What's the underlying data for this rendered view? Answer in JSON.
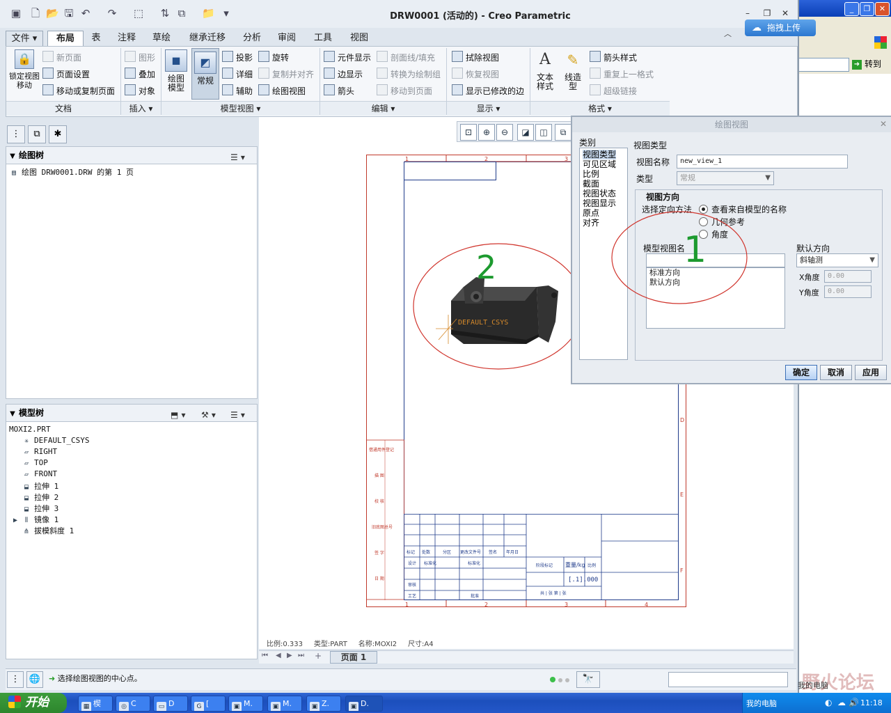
{
  "window": {
    "title": "DRW0001 (活动的) - Creo Parametric",
    "cloud_upload_label": "拖拽上传"
  },
  "bg_window": {
    "goto_label": "转到"
  },
  "tabs": [
    "文件",
    "布局",
    "表",
    "注释",
    "草绘",
    "继承迁移",
    "分析",
    "审阅",
    "工具",
    "视图"
  ],
  "ribbon": {
    "lock_view": "锁定视图移动",
    "doc": {
      "new_page": "新页面",
      "page_setup": "页面设置",
      "move_copy_page": "移动或复制页面",
      "group": "文档"
    },
    "insert": {
      "shape": "图形",
      "overlay": "叠加",
      "object": "对象",
      "group": "插入"
    },
    "model_view": {
      "drawing_model": "绘图模型",
      "general": "常规",
      "projection": "投影",
      "detail": "详细",
      "auxiliary": "辅助",
      "revolve": "旋转",
      "copy_align": "复制并对齐",
      "drawing_view": "绘图视图",
      "group": "模型视图"
    },
    "edit": {
      "element_display": "元件显示",
      "edge_display": "边显示",
      "arrow": "箭头",
      "section_fill": "剖面线/填充",
      "convert_group": "转换为绘制组",
      "move_to_page": "移动到页面",
      "group": "编辑"
    },
    "display": {
      "erase_view": "拭除视图",
      "resume_view": "恢复视图",
      "show_modified_edges": "显示已修改的边",
      "group": "显示"
    },
    "format": {
      "text_style": "文本样式",
      "line_style": "线造型",
      "arrow_style": "箭头样式",
      "repeat_format": "重复上一格式",
      "hyperlink": "超级链接",
      "group": "格式"
    }
  },
  "drawing_tree": {
    "title": "绘图树",
    "item": "绘图 DRW0001.DRW 的第 1 页"
  },
  "model_tree": {
    "title": "模型树",
    "items": [
      "MOXI2.PRT",
      "DEFAULT_CSYS",
      "RIGHT",
      "TOP",
      "FRONT",
      "拉伸 1",
      "拉伸 2",
      "拉伸 3",
      "镜像 1",
      "拔模斜度 1"
    ]
  },
  "sheet": {
    "col_labels": [
      "1",
      "2",
      "3",
      "4"
    ],
    "row_labels": [
      "D",
      "E",
      "F"
    ],
    "csys_label": "DEFAULT_CSYS",
    "annotation_1": "1",
    "annotation_2": "2",
    "side_labels": [
      "借通用件登记",
      "描 图",
      "校 核",
      "旧底图总号",
      "签 字",
      "日 期"
    ],
    "title_block": {
      "row1": [
        "标记",
        "处数",
        "分区",
        "更改文件号",
        "签名",
        "年月日"
      ],
      "design": "设计",
      "standardize": "标准化",
      "review": "审核",
      "process": "工艺",
      "approve": "批准",
      "stage_mark": "阶段标记",
      "weight": "重量/kg",
      "scale": "比例",
      "scale_value": "[.1].000",
      "sheets": "共 | 张 第 | 张"
    }
  },
  "status_info": {
    "scale": "比例:0.333",
    "type": "类型:PART",
    "name": "名称:MOXI2",
    "size": "尺寸:A4"
  },
  "pager": {
    "page": "页面 1"
  },
  "status_message": "选择绘图视图的中心点。",
  "dialog": {
    "title": "绘图视图",
    "category_label": "类别",
    "categories": [
      "视图类型",
      "可见区域",
      "比例",
      "截面",
      "视图状态",
      "视图显示",
      "原点",
      "对齐"
    ],
    "view_type_label": "视图类型",
    "view_name_label": "视图名称",
    "view_name_value": "new_view_1",
    "type_label": "类型",
    "type_value": "常规",
    "orientation_label": "视图方向",
    "method_label": "选择定向方法",
    "method_options": [
      "查看来自模型的名称",
      "几何参考",
      "角度"
    ],
    "model_view_name_label": "模型视图名",
    "model_view_names": [
      "标准方向",
      "默认方向"
    ],
    "default_orientation_label": "默认方向",
    "default_orientation_value": "斜轴测",
    "x_angle_label": "X角度",
    "x_angle_value": "0.00",
    "y_angle_label": "Y角度",
    "y_angle_value": "0.00",
    "buttons": {
      "ok": "确定",
      "cancel": "取消",
      "apply": "应用"
    }
  },
  "taskbar": {
    "start": "开始",
    "buttons": [
      "楔",
      "C",
      "D",
      "[",
      "M.",
      "M.",
      "Z.",
      "D."
    ],
    "tray_label": "我的电脑",
    "clock": "11:18",
    "desktop_label": "我的电脑"
  },
  "watermark": "野火论坛"
}
